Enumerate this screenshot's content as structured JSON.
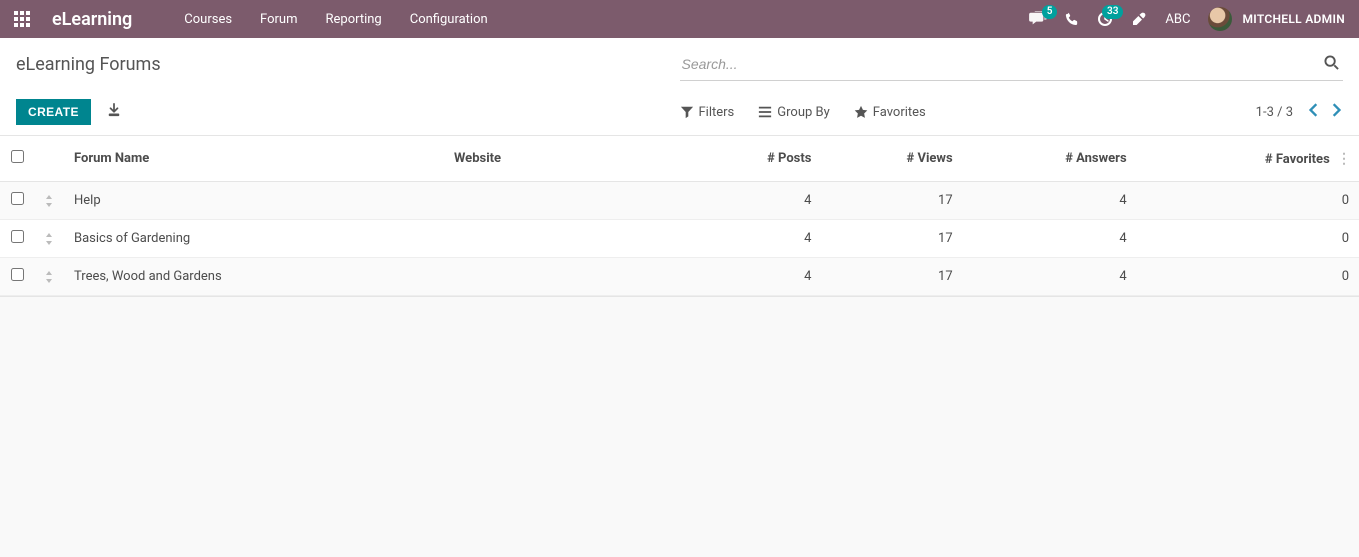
{
  "navbar": {
    "brand": "eLearning",
    "menu": [
      "Courses",
      "Forum",
      "Reporting",
      "Configuration"
    ],
    "chat_badge": "5",
    "clock_badge": "33",
    "abc": "ABC",
    "user_name": "MITCHELL ADMIN"
  },
  "page": {
    "title": "eLearning Forums",
    "create_label": "CREATE",
    "search_placeholder": "Search...",
    "filters_label": "Filters",
    "groupby_label": "Group By",
    "favorites_label": "Favorites",
    "pager": "1-3 / 3"
  },
  "table": {
    "headers": {
      "name": "Forum Name",
      "website": "Website",
      "posts": "# Posts",
      "views": "# Views",
      "answers": "# Answers",
      "favorites": "# Favorites"
    },
    "rows": [
      {
        "name": "Help",
        "website": "",
        "posts": 4,
        "views": 17,
        "answers": 4,
        "favorites": 0
      },
      {
        "name": "Basics of Gardening",
        "website": "",
        "posts": 4,
        "views": 17,
        "answers": 4,
        "favorites": 0
      },
      {
        "name": "Trees, Wood and Gardens",
        "website": "",
        "posts": 4,
        "views": 17,
        "answers": 4,
        "favorites": 0
      }
    ]
  }
}
